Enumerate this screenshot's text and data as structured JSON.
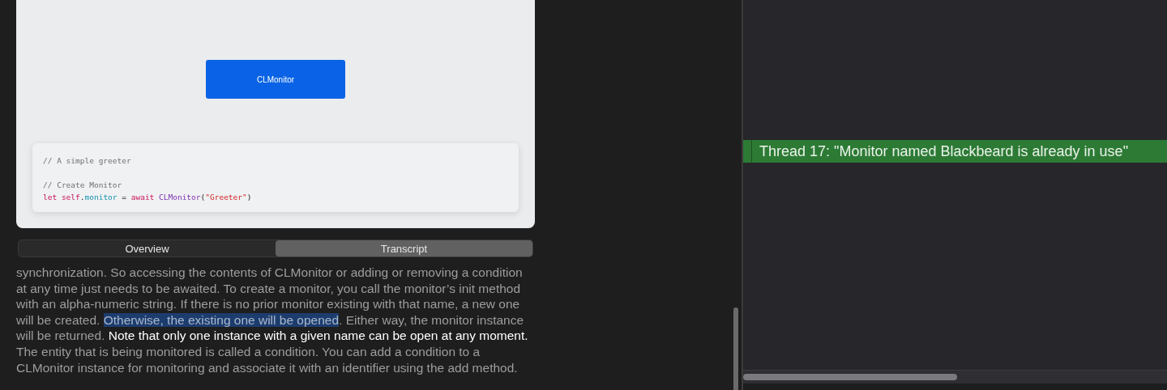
{
  "preview": {
    "button": {
      "label": "CLMonitor"
    },
    "code": [
      [
        {
          "kind": "comment",
          "text": "// A simple greeter"
        }
      ],
      [
        {
          "kind": "comment",
          "text": "// Create Monitor"
        }
      ],
      [
        {
          "kind": "keyword",
          "text": "let self"
        },
        {
          "kind": "plain",
          "text": "."
        },
        {
          "kind": "property",
          "text": "monitor"
        },
        {
          "kind": "plain",
          "text": " = "
        },
        {
          "kind": "keyword",
          "text": "await"
        },
        {
          "kind": "type",
          "text": " CLMonitor"
        },
        {
          "kind": "plain",
          "text": "("
        },
        {
          "kind": "string",
          "text": "\"Greeter\""
        },
        {
          "kind": "plain",
          "text": ")"
        }
      ]
    ]
  },
  "tabs": [
    {
      "label": "Overview",
      "selected": false
    },
    {
      "label": "Transcript",
      "selected": true
    }
  ],
  "transcript": [
    {
      "kind": "plain",
      "text": "synchronization. So accessing the contents of CLMonitor or adding or removing a condition at any time just needs to be awaited. To create a monitor, you call the monitor’s init method with an alpha-numeric string. If there is no prior monitor existing with that name, a new one will be created. "
    },
    {
      "kind": "selected",
      "text": "Otherwise, the existing one will be opened"
    },
    {
      "kind": "plain",
      "text": ". Either way, the monitor instance will be returned. "
    },
    {
      "kind": "current",
      "text": "Note that only one instance with a given name can be open at any moment."
    },
    {
      "kind": "plain",
      "text": " The entity that is being monitored is called a condition. You can add a condition to a CLMonitor instance for monitoring and associate it with an identifier using the add method."
    }
  ],
  "editor": {
    "thread_banner": "Thread 17: \"Monitor named Blackbeard is already in use\""
  }
}
